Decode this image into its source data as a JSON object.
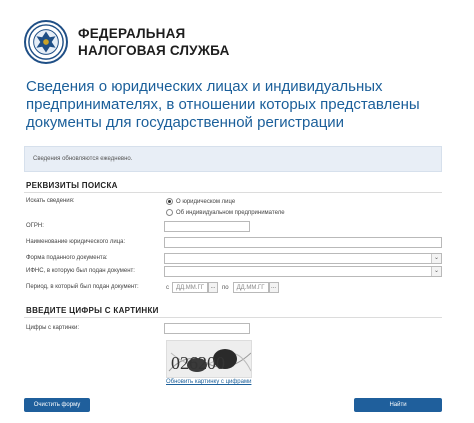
{
  "header": {
    "org_line1": "ФЕДЕРАЛЬНАЯ",
    "org_line2": "НАЛОГОВАЯ СЛУЖБА",
    "logo_icon": "fns-emblem-icon"
  },
  "page_title": "Сведения о юридических лицах и индивидуальных предпринимателях, в отношении которых представлены документы для государственной регистрации",
  "info_text": "Сведения обновляются ежедневно.",
  "search_section": {
    "title": "РЕКВИЗИТЫ ПОИСКА",
    "search_label": "Искать сведения:",
    "radio_legal": "О юридическом лице",
    "radio_individual": "Об индивидуальном предпринимателе",
    "ogrn_label": "ОГРН:",
    "name_label": "Наименование юридического лица:",
    "doc_form_label": "Форма поданного документа:",
    "ifns_label": "ИФНС, в которую был подан документ:",
    "period_label": "Период, в который был подан документ:",
    "period_from_prefix": "с",
    "period_from_placeholder": "ДД.ММ.ГГ",
    "period_to_prefix": "по",
    "period_to_placeholder": "ДД.ММ.ГГ",
    "calendar_icon_glyph": "...",
    "dropdown_arrow_glyph": "⌄"
  },
  "captcha_section": {
    "title": "ВВЕДИТЕ ЦИФРЫ С КАРТИНКИ",
    "digits_label": "Цифры с картинки:",
    "captcha_text": "026200",
    "refresh_link": "Обновить картинку с цифрами"
  },
  "buttons": {
    "clear": "Очистить форму",
    "find": "Найти"
  },
  "colors": {
    "title_blue": "#1b5f9a",
    "button_blue": "#1f5f9c",
    "info_bg": "#e8eef6"
  }
}
